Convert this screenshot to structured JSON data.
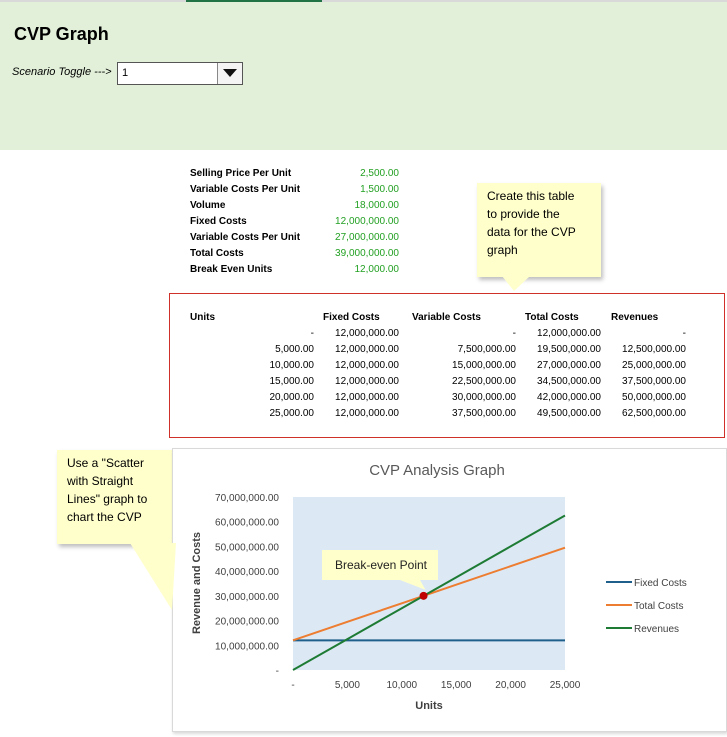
{
  "header": {
    "title": "CVP Graph",
    "toggle_label": "Scenario Toggle --->",
    "toggle_value": "1"
  },
  "inputs": [
    {
      "label": "Selling Price Per Unit",
      "value": "2,500.00"
    },
    {
      "label": "Variable Costs Per Unit",
      "value": "1,500.00"
    },
    {
      "label": "Volume",
      "value": "18,000.00"
    },
    {
      "label": "Fixed Costs",
      "value": "12,000,000.00"
    },
    {
      "label": "Variable Costs Per Unit",
      "value": "27,000,000.00"
    },
    {
      "label": "Total Costs",
      "value": "39,000,000.00"
    },
    {
      "label": "Break Even Units",
      "value": "12,000.00"
    }
  ],
  "callouts": {
    "table_note": [
      "Create this table",
      "to provide the",
      "data for the CVP",
      "graph"
    ],
    "chart_note": [
      "Use a \"Scatter",
      "with Straight",
      "Lines\" graph to",
      "chart the CVP"
    ]
  },
  "table": {
    "headers": [
      "Units",
      "Fixed Costs",
      "Variable Costs",
      "Total Costs",
      "Revenues"
    ],
    "rows": [
      [
        "-",
        "12,000,000.00",
        "-",
        "12,000,000.00",
        "-"
      ],
      [
        "5,000.00",
        "12,000,000.00",
        "7,500,000.00",
        "19,500,000.00",
        "12,500,000.00"
      ],
      [
        "10,000.00",
        "12,000,000.00",
        "15,000,000.00",
        "27,000,000.00",
        "25,000,000.00"
      ],
      [
        "15,000.00",
        "12,000,000.00",
        "22,500,000.00",
        "34,500,000.00",
        "37,500,000.00"
      ],
      [
        "20,000.00",
        "12,000,000.00",
        "30,000,000.00",
        "42,000,000.00",
        "50,000,000.00"
      ],
      [
        "25,000.00",
        "12,000,000.00",
        "37,500,000.00",
        "49,500,000.00",
        "62,500,000.00"
      ]
    ]
  },
  "colors": {
    "banner": "#e2f0d9",
    "value_green": "#22a022",
    "table_border": "#d0302a",
    "callout_fill": "#ffffcc",
    "plot_bg": "#dce9f5",
    "fixed": "#1f5f8b",
    "total": "#ed7d31",
    "revenue": "#1e7b34",
    "breakeven_point": "#c00000"
  },
  "chart_data": {
    "type": "line",
    "title": "CVP Analysis Graph",
    "xlabel": "Units",
    "ylabel": "Revenue and Costs",
    "xlim": [
      0,
      25000
    ],
    "ylim": [
      0,
      70000000
    ],
    "x_ticks": [
      "-",
      "5,000",
      "10,000",
      "15,000",
      "20,000",
      "25,000"
    ],
    "y_ticks": [
      "-",
      "10,000,000.00",
      "20,000,000.00",
      "30,000,000.00",
      "40,000,000.00",
      "50,000,000.00",
      "60,000,000.00",
      "70,000,000.00"
    ],
    "x": [
      0,
      5000,
      10000,
      15000,
      20000,
      25000
    ],
    "series": [
      {
        "name": "Fixed Costs",
        "values": [
          12000000,
          12000000,
          12000000,
          12000000,
          12000000,
          12000000
        ]
      },
      {
        "name": "Total Costs",
        "values": [
          12000000,
          19500000,
          27000000,
          34500000,
          42000000,
          49500000
        ]
      },
      {
        "name": "Revenues",
        "values": [
          0,
          12500000,
          25000000,
          37500000,
          50000000,
          62500000
        ]
      }
    ],
    "annotation": {
      "label": "Break-even Point",
      "x": 12000,
      "y": 30000000
    },
    "legend": "right",
    "grid": false
  }
}
